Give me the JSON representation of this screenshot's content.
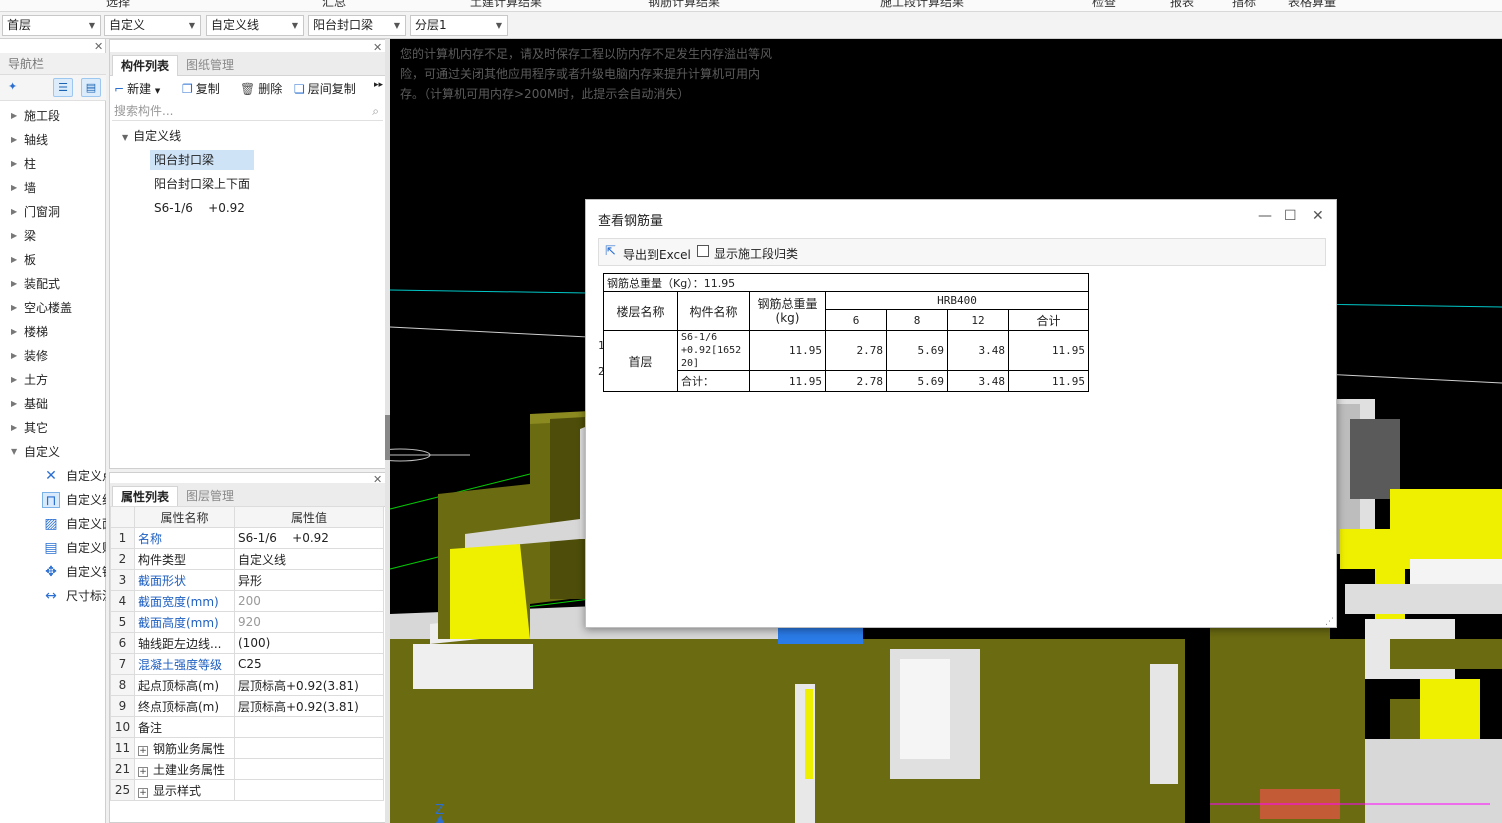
{
  "ribbon": {
    "items": [
      "选择",
      "汇总",
      "土建计算结果",
      "钢筋计算结果",
      "施工段计算结果",
      "检查",
      "报表",
      "指标",
      "表格算量"
    ]
  },
  "selectors": [
    {
      "value": "首层"
    },
    {
      "value": "自定义"
    },
    {
      "value": "自定义线"
    },
    {
      "value": "阳台封口梁"
    },
    {
      "value": "分层1"
    }
  ],
  "nav": {
    "title": "导航栏",
    "items": [
      "施工段",
      "轴线",
      "柱",
      "墙",
      "门窗洞",
      "梁",
      "板",
      "装配式",
      "空心楼盖",
      "楼梯",
      "装修",
      "土方",
      "基础",
      "其它",
      "自定义"
    ],
    "sub_items": [
      "自定义点",
      "自定义线",
      "自定义面",
      "自定义贴面",
      "自定义钢筋",
      "尺寸标注"
    ]
  },
  "component_panel": {
    "tabs": [
      "构件列表",
      "图纸管理"
    ],
    "toolbar": {
      "new": "新建",
      "copy": "复制",
      "delete": "删除",
      "floor_copy": "层间复制"
    },
    "search_placeholder": "搜索构件...",
    "tree_root": "自定义线",
    "tree_items": [
      "阳台封口梁",
      "阳台封口梁上下面",
      "S6-1/6    +0.92"
    ]
  },
  "property_panel": {
    "tabs": [
      "属性列表",
      "图层管理"
    ],
    "col_name": "属性名称",
    "col_value": "属性值",
    "rows": [
      {
        "n": "1",
        "name": "名称",
        "value": "S6-1/6    +0.92"
      },
      {
        "n": "2",
        "name": "构件类型",
        "value": "自定义线"
      },
      {
        "n": "3",
        "name": "截面形状",
        "value": "异形"
      },
      {
        "n": "4",
        "name": "截面宽度(mm)",
        "value": "200"
      },
      {
        "n": "5",
        "name": "截面高度(mm)",
        "value": "920"
      },
      {
        "n": "6",
        "name": "轴线距左边线...",
        "value": "(100)"
      },
      {
        "n": "7",
        "name": "混凝土强度等级",
        "value": "C25"
      },
      {
        "n": "8",
        "name": "起点顶标高(m)",
        "value": "层顶标高+0.92(3.81)"
      },
      {
        "n": "9",
        "name": "终点顶标高(m)",
        "value": "层顶标高+0.92(3.81)"
      },
      {
        "n": "10",
        "name": "备注",
        "value": ""
      },
      {
        "n": "11",
        "name": "钢筋业务属性",
        "value": ""
      },
      {
        "n": "21",
        "name": "土建业务属性",
        "value": ""
      },
      {
        "n": "25",
        "name": "显示样式",
        "value": ""
      }
    ]
  },
  "viewport": {
    "warning": "您的计算机内存不足，请及时保存工程以防内存不足发生内存溢出等风险，可通过关闭其他应用程序或者升级电脑内存来提升计算机可用内存。（计算机可用内存>200M时，此提示会自动消失）",
    "axis_label": "Z"
  },
  "dialog": {
    "title": "查看钢筋量",
    "export_label": "导出到Excel",
    "checkbox_label": "显示施工段归类",
    "table": {
      "total_line": "钢筋总重量（Kg）：11.95",
      "h_floor": "楼层名称",
      "h_component": "构件名称",
      "h_total": "钢筋总重量(kg)",
      "h_grade": "HRB400",
      "diameters": [
        "6",
        "8",
        "12",
        "合计"
      ],
      "floor": "首层",
      "row1": {
        "num": "1",
        "component": "S6-1/6    +0.92[165220]",
        "total": "11.95",
        "d6": "2.78",
        "d8": "5.69",
        "d12": "3.48",
        "sum": "11.95"
      },
      "row2": {
        "num": "2",
        "component": "合计：",
        "total": "11.95",
        "d6": "2.78",
        "d8": "5.69",
        "d12": "3.48",
        "sum": "11.95"
      }
    }
  }
}
